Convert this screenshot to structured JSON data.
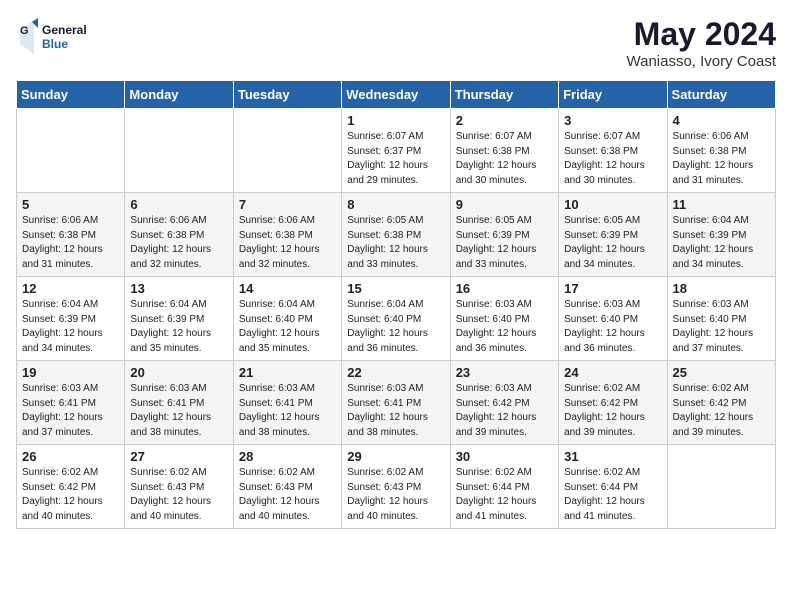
{
  "logo": {
    "line1": "General",
    "line2": "Blue"
  },
  "title": "May 2024",
  "subtitle": "Waniasso, Ivory Coast",
  "days_header": [
    "Sunday",
    "Monday",
    "Tuesday",
    "Wednesday",
    "Thursday",
    "Friday",
    "Saturday"
  ],
  "weeks": [
    [
      {
        "day": "",
        "info": ""
      },
      {
        "day": "",
        "info": ""
      },
      {
        "day": "",
        "info": ""
      },
      {
        "day": "1",
        "info": "Sunrise: 6:07 AM\nSunset: 6:37 PM\nDaylight: 12 hours\nand 29 minutes."
      },
      {
        "day": "2",
        "info": "Sunrise: 6:07 AM\nSunset: 6:38 PM\nDaylight: 12 hours\nand 30 minutes."
      },
      {
        "day": "3",
        "info": "Sunrise: 6:07 AM\nSunset: 6:38 PM\nDaylight: 12 hours\nand 30 minutes."
      },
      {
        "day": "4",
        "info": "Sunrise: 6:06 AM\nSunset: 6:38 PM\nDaylight: 12 hours\nand 31 minutes."
      }
    ],
    [
      {
        "day": "5",
        "info": "Sunrise: 6:06 AM\nSunset: 6:38 PM\nDaylight: 12 hours\nand 31 minutes."
      },
      {
        "day": "6",
        "info": "Sunrise: 6:06 AM\nSunset: 6:38 PM\nDaylight: 12 hours\nand 32 minutes."
      },
      {
        "day": "7",
        "info": "Sunrise: 6:06 AM\nSunset: 6:38 PM\nDaylight: 12 hours\nand 32 minutes."
      },
      {
        "day": "8",
        "info": "Sunrise: 6:05 AM\nSunset: 6:38 PM\nDaylight: 12 hours\nand 33 minutes."
      },
      {
        "day": "9",
        "info": "Sunrise: 6:05 AM\nSunset: 6:39 PM\nDaylight: 12 hours\nand 33 minutes."
      },
      {
        "day": "10",
        "info": "Sunrise: 6:05 AM\nSunset: 6:39 PM\nDaylight: 12 hours\nand 34 minutes."
      },
      {
        "day": "11",
        "info": "Sunrise: 6:04 AM\nSunset: 6:39 PM\nDaylight: 12 hours\nand 34 minutes."
      }
    ],
    [
      {
        "day": "12",
        "info": "Sunrise: 6:04 AM\nSunset: 6:39 PM\nDaylight: 12 hours\nand 34 minutes."
      },
      {
        "day": "13",
        "info": "Sunrise: 6:04 AM\nSunset: 6:39 PM\nDaylight: 12 hours\nand 35 minutes."
      },
      {
        "day": "14",
        "info": "Sunrise: 6:04 AM\nSunset: 6:40 PM\nDaylight: 12 hours\nand 35 minutes."
      },
      {
        "day": "15",
        "info": "Sunrise: 6:04 AM\nSunset: 6:40 PM\nDaylight: 12 hours\nand 36 minutes."
      },
      {
        "day": "16",
        "info": "Sunrise: 6:03 AM\nSunset: 6:40 PM\nDaylight: 12 hours\nand 36 minutes."
      },
      {
        "day": "17",
        "info": "Sunrise: 6:03 AM\nSunset: 6:40 PM\nDaylight: 12 hours\nand 36 minutes."
      },
      {
        "day": "18",
        "info": "Sunrise: 6:03 AM\nSunset: 6:40 PM\nDaylight: 12 hours\nand 37 minutes."
      }
    ],
    [
      {
        "day": "19",
        "info": "Sunrise: 6:03 AM\nSunset: 6:41 PM\nDaylight: 12 hours\nand 37 minutes."
      },
      {
        "day": "20",
        "info": "Sunrise: 6:03 AM\nSunset: 6:41 PM\nDaylight: 12 hours\nand 38 minutes."
      },
      {
        "day": "21",
        "info": "Sunrise: 6:03 AM\nSunset: 6:41 PM\nDaylight: 12 hours\nand 38 minutes."
      },
      {
        "day": "22",
        "info": "Sunrise: 6:03 AM\nSunset: 6:41 PM\nDaylight: 12 hours\nand 38 minutes."
      },
      {
        "day": "23",
        "info": "Sunrise: 6:03 AM\nSunset: 6:42 PM\nDaylight: 12 hours\nand 39 minutes."
      },
      {
        "day": "24",
        "info": "Sunrise: 6:02 AM\nSunset: 6:42 PM\nDaylight: 12 hours\nand 39 minutes."
      },
      {
        "day": "25",
        "info": "Sunrise: 6:02 AM\nSunset: 6:42 PM\nDaylight: 12 hours\nand 39 minutes."
      }
    ],
    [
      {
        "day": "26",
        "info": "Sunrise: 6:02 AM\nSunset: 6:42 PM\nDaylight: 12 hours\nand 40 minutes."
      },
      {
        "day": "27",
        "info": "Sunrise: 6:02 AM\nSunset: 6:43 PM\nDaylight: 12 hours\nand 40 minutes."
      },
      {
        "day": "28",
        "info": "Sunrise: 6:02 AM\nSunset: 6:43 PM\nDaylight: 12 hours\nand 40 minutes."
      },
      {
        "day": "29",
        "info": "Sunrise: 6:02 AM\nSunset: 6:43 PM\nDaylight: 12 hours\nand 40 minutes."
      },
      {
        "day": "30",
        "info": "Sunrise: 6:02 AM\nSunset: 6:44 PM\nDaylight: 12 hours\nand 41 minutes."
      },
      {
        "day": "31",
        "info": "Sunrise: 6:02 AM\nSunset: 6:44 PM\nDaylight: 12 hours\nand 41 minutes."
      },
      {
        "day": "",
        "info": ""
      }
    ]
  ]
}
